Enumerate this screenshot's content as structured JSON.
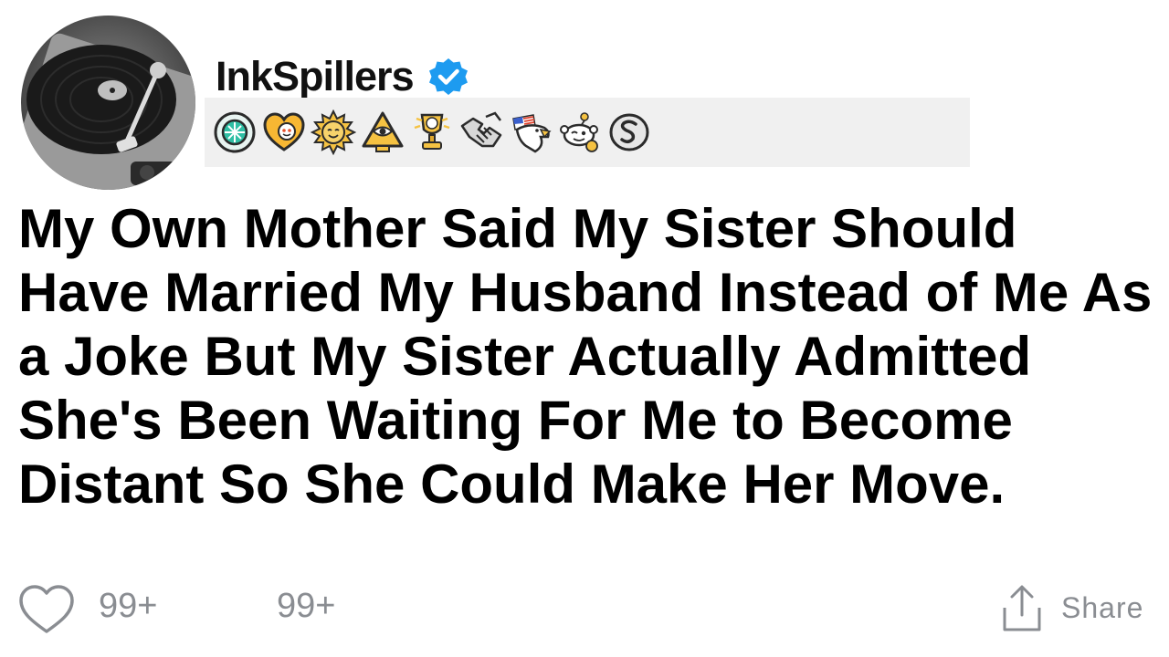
{
  "post": {
    "username": "InkSpillers",
    "verified": true,
    "title": "My Own Mother Said My Sister Should Have Married My Husband Instead of Me As a Joke But My Sister Actually Admitted She's Been Waiting For Me to Become Distant So She Could Make Her Move."
  },
  "awards": [
    {
      "icon": "gem-award-icon"
    },
    {
      "icon": "heart-snoo-award-icon"
    },
    {
      "icon": "sun-face-award-icon"
    },
    {
      "icon": "pyramid-eye-award-icon"
    },
    {
      "icon": "gold-trophy-snoo-award-icon"
    },
    {
      "icon": "handshake-award-icon"
    },
    {
      "icon": "eagle-flag-award-icon"
    },
    {
      "icon": "snoo-wink-award-icon"
    },
    {
      "icon": "silver-s-award-icon"
    }
  ],
  "footer": {
    "likes_count": "99+",
    "comments_count": "99+",
    "share_label": "Share"
  },
  "colors": {
    "verified_blue": "#1d9bf0",
    "meta_gray": "#8a8d92",
    "awards_bg": "#f0f0f0",
    "title_text": "#000000"
  }
}
